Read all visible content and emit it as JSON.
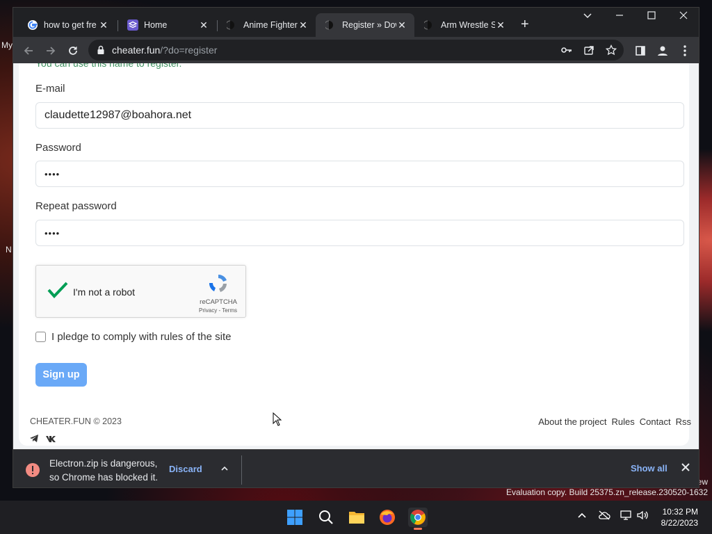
{
  "desktop": {
    "label_my": "My",
    "label_n": "N",
    "label_ew": "ew",
    "watermark": "Evaluation copy. Build 25375.zn_release.230520-1632"
  },
  "tabs": [
    {
      "title": "how to get fre",
      "icon": "google-icon"
    },
    {
      "title": "Home",
      "icon": "stack-icon"
    },
    {
      "title": "Anime Fighter",
      "icon": "cheater-icon"
    },
    {
      "title": "Register » Dow",
      "icon": "cheater-icon",
      "active": true
    },
    {
      "title": "Arm Wrestle S",
      "icon": "cheater-icon"
    }
  ],
  "address": {
    "domain": "cheater.fun",
    "path": "/?do=register"
  },
  "form": {
    "hint": "You can use this name to register.",
    "email_label": "E-mail",
    "email_value": "claudette12987@boahora.net",
    "password_label": "Password",
    "password_value": "••••",
    "repeat_label": "Repeat password",
    "repeat_value": "••••",
    "captcha_text": "I'm not a robot",
    "captcha_brand": "reCAPTCHA",
    "captcha_links": "Privacy - Terms",
    "pledge_text": "I pledge to comply with rules of the site",
    "signup_label": "Sign up"
  },
  "footer": {
    "copyright": "CHEATER.FUN © 2023",
    "links": [
      "About the project",
      "Rules",
      "Contact",
      "Rss"
    ]
  },
  "download": {
    "line1": "Electron.zip is dangerous,",
    "line2": "so Chrome has blocked it.",
    "discard": "Discard",
    "show_all": "Show all"
  },
  "clock": {
    "time": "10:32 PM",
    "date": "8/22/2023"
  },
  "colors": {
    "accent": "#6aa9f7",
    "check": "#009e55",
    "link": "#8ab4f8",
    "danger": "#f28b82"
  }
}
